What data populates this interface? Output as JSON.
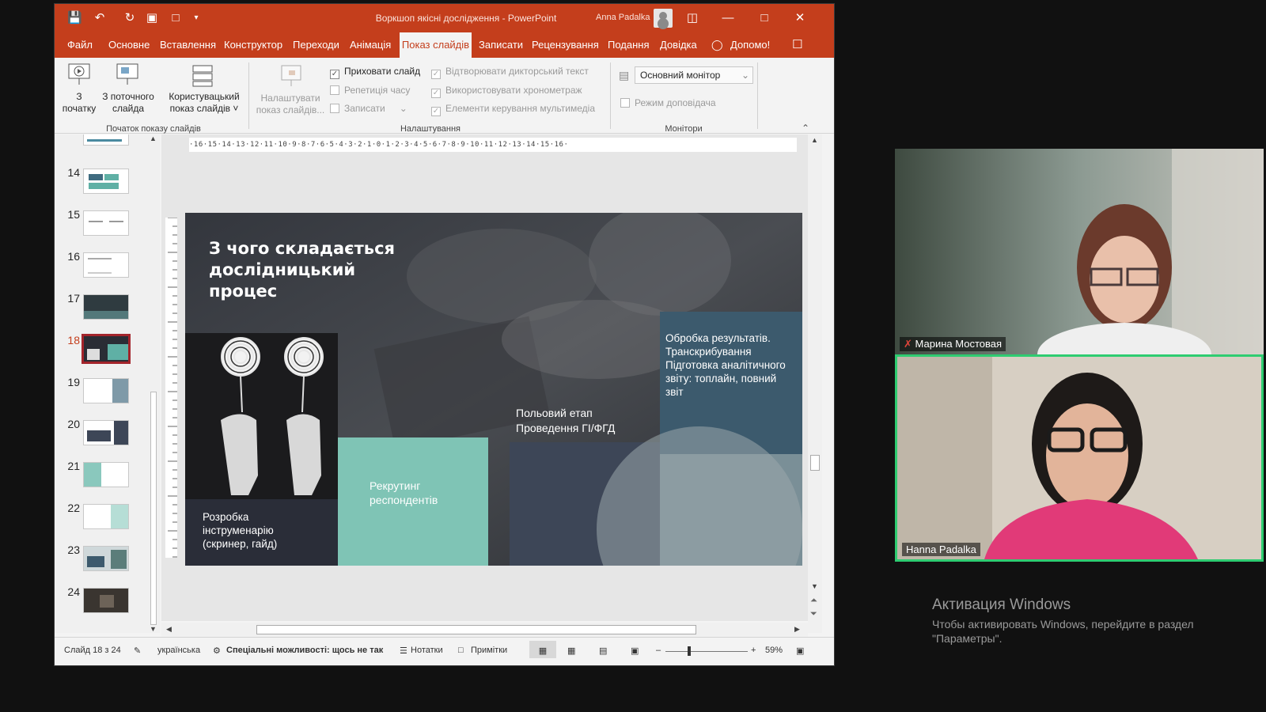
{
  "window": {
    "title": "Воркшоп якісні дослідження  -  PowerPoint",
    "user": "Anna Padalka"
  },
  "menu": {
    "items": [
      "Файл",
      "Основне",
      "Вставлення",
      "Конструктор",
      "Переходи",
      "Анімація",
      "Показ слайдів",
      "Записати",
      "Рецензування",
      "Подання",
      "Довідка",
      "Допомо!"
    ],
    "active": "Показ слайдів"
  },
  "ribbon": {
    "from_start_line1": "З",
    "from_start_line2": "початку",
    "from_current_line1": "З поточного",
    "from_current_line2": "слайда",
    "custom_line1": "Користувацький",
    "custom_line2": "показ слайдів ˅",
    "group_start": "Початок показу слайдів",
    "setup_line1": "Налаштувати",
    "setup_line2": "показ слайдів...",
    "hide_slide": "Приховати слайд",
    "rehearse": "Репетиція часу",
    "record": "Записати",
    "play_narration": "Відтворювати дикторський текст",
    "use_timings": "Використовувати хронометраж",
    "media_controls": "Елементи керування мультимедіа",
    "group_setup": "Налаштування",
    "monitor": "Основний монітор",
    "presenter_view": "Режим доповідача",
    "group_monitors": "Монітори"
  },
  "thumbnails": {
    "numbers": [
      "14",
      "15",
      "16",
      "17",
      "18",
      "19",
      "20",
      "21",
      "22",
      "23",
      "24"
    ],
    "selected": "18"
  },
  "ruler": {
    "horizontal": "·16·15·14·13·12·11·10·9·8·7·6·5·4·3·2·1·0·1·2·3·4·5·6·7·8·9·10·11·12·13·14·15·16·"
  },
  "slide": {
    "title": "З чого складається дослідницький процес",
    "step1": "Розробка інструменарію (скринер, гайд)",
    "step2": "Рекрутинг респондентів",
    "step3": "Польовий етап Проведення ГІ/ФГД",
    "step4": "Обробка результатів. Транскрибування Підготовка аналітичного звіту: топлайн, повний звіт"
  },
  "status": {
    "slide_counter": "Слайд 18 з 24",
    "language": "українська",
    "accessibility": "Спеціальні можливості: щось не так",
    "notes": "Нотатки",
    "comments": "Примітки",
    "zoom": "59%"
  },
  "video": {
    "participant1": "Марина Мостовая",
    "participant2": "Hanna Padalka"
  },
  "activation": {
    "title": "Активация Windows",
    "description": "Чтобы активировать Windows, перейдите в раздел \"Параметры\"."
  },
  "colors": {
    "accent": "#c43e1c",
    "slide_dark": "#2a2d35",
    "slide_teal": "#7fc4b5",
    "slide_slate": "#3d4657",
    "slide_blue": "#3c5a6d",
    "speaker_highlight": "#2ecc71"
  }
}
